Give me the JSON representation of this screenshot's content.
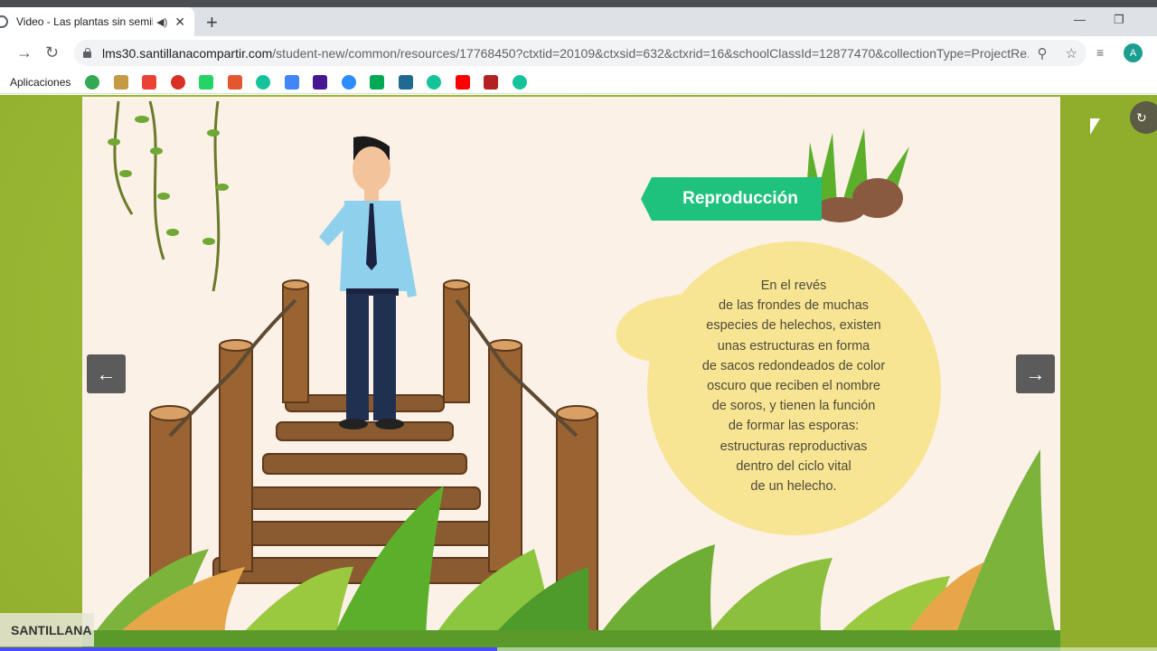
{
  "browser": {
    "tab_title": "Video - Las plantas sin semillas",
    "new_tab": "+",
    "url_host": "lms30.santillanacompartir.com",
    "url_path": "/student-new/common/resources/17768450?ctxtid=20109&ctxsid=632&ctxrid=16&schoolClassId=12877470&collectionType=ProjectRe...",
    "avatar_letter": "A",
    "bookmarks_label": "Aplicaciones",
    "bookmark_icons": [
      "maps-icon",
      "people-icon",
      "wave-icon",
      "gmail-icon",
      "whatsapp-icon",
      "s-icon",
      "grammarly-icon",
      "circle-icon",
      "kahoot-icon",
      "zoom-icon",
      "c-icon",
      "film-icon",
      "grammarly-icon-2",
      "youtube-icon",
      "shield-icon",
      "grammarly-icon-3"
    ],
    "bookmark_colors": [
      "#34a853",
      "#c49a45",
      "#ea4335",
      "#d93025",
      "#25d366",
      "#e4572e",
      "#15c39a",
      "#4285f4",
      "#46178f",
      "#2d8cff",
      "#0a5",
      "#1e6b8f",
      "#15c39a",
      "#ff0000",
      "#b22222",
      "#15c39a"
    ]
  },
  "slide": {
    "heading": "Reproducción",
    "body_lines": [
      "En el revés",
      "de las frondes de muchas",
      "especies de helechos, existen",
      "unas estructuras en forma",
      "de sacos redondeados de color",
      "oscuro que reciben el nombre",
      "de soros, y tienen la función",
      "de formar las esporas:",
      "estructuras reproductivas",
      "dentro del ciclo vital",
      "de un helecho."
    ],
    "prev_arrow": "←",
    "next_arrow": "→"
  },
  "player": {
    "brand": "SANTILLANA",
    "progress": 0.43
  },
  "colors": {
    "banner": "#1fc27d",
    "bubble": "#f7e594",
    "stage_bg": "#fbf1e7",
    "outer_green": "#8fae2c"
  }
}
